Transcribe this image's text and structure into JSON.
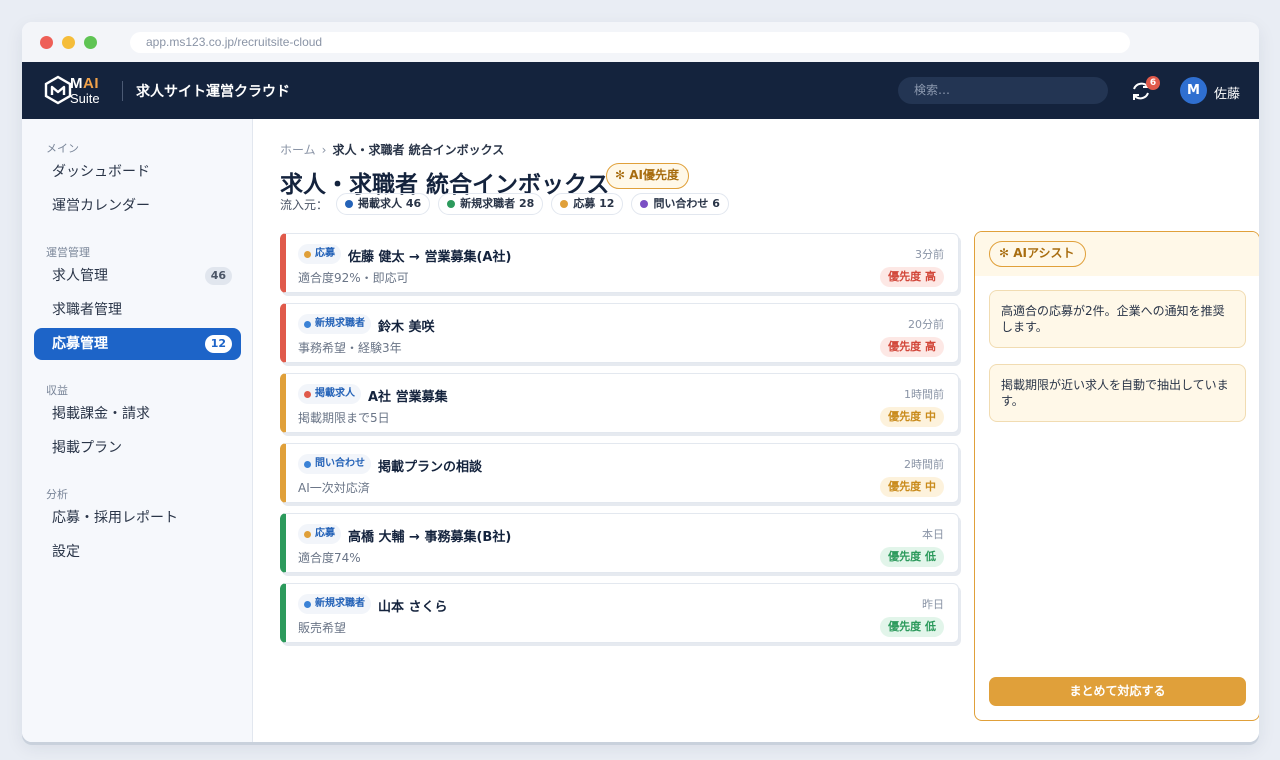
{
  "browser": {
    "url": "app.ms123.co.jp/recruitsite-cloud"
  },
  "appbar": {
    "logo_mai_m": "M",
    "logo_mai_ai": "AI",
    "logo_suite": "Suite",
    "title": "求人サイト運営クラウド",
    "search_placeholder": "検索…",
    "sync_badge": "6",
    "avatar_initial": "M",
    "user_name": "佐藤"
  },
  "sidebar": {
    "sections": [
      {
        "label": "メイン"
      },
      {
        "label": "運営管理"
      },
      {
        "label": "収益"
      },
      {
        "label": "分析"
      }
    ],
    "items": [
      {
        "label": "ダッシュボード"
      },
      {
        "label": "運営カレンダー"
      },
      {
        "label": "求人管理",
        "badge": "46"
      },
      {
        "label": "求職者管理"
      },
      {
        "label": "応募管理",
        "badge": "12",
        "active": true
      },
      {
        "label": "掲載課金・請求"
      },
      {
        "label": "掲載プラン"
      },
      {
        "label": "応募・採用レポート"
      },
      {
        "label": "設定"
      }
    ]
  },
  "main": {
    "breadcrumb": {
      "home": "ホーム",
      "sep": "›",
      "current": "求人・求職者 統合インボックス"
    },
    "title": "求人・求職者 統合インボックス",
    "ai_badge": "AI優先度",
    "sources_label": "流入元：",
    "sources": [
      {
        "label": "掲載求人 46",
        "color": "#2563b8"
      },
      {
        "label": "新規求職者 28",
        "color": "#2c9a5c"
      },
      {
        "label": "応募 12",
        "color": "#e0a03a"
      },
      {
        "label": "問い合わせ 6",
        "color": "#7b4fc4"
      }
    ],
    "cards": [
      {
        "tag": "応募",
        "tag_color": "#e0a03a",
        "title": "佐藤 健太 → 営業募集(A社)",
        "sub": "適合度92%・即応可",
        "time": "3分前",
        "priority": "優先度 高",
        "level": "high",
        "bar": "#e05a4b"
      },
      {
        "tag": "新規求職者",
        "tag_color": "#3b82d6",
        "title": "鈴木 美咲",
        "sub": "事務希望・経験3年",
        "time": "20分前",
        "priority": "優先度 高",
        "level": "high",
        "bar": "#e05a4b"
      },
      {
        "tag": "掲載求人",
        "tag_color": "#e05a4b",
        "title": "A社 営業募集",
        "sub": "掲載期限まで5日",
        "time": "1時間前",
        "priority": "優先度 中",
        "level": "mid",
        "bar": "#e0a03a"
      },
      {
        "tag": "問い合わせ",
        "tag_color": "#3b82d6",
        "title": "掲載プランの相談",
        "sub": "AI一次対応済",
        "time": "2時間前",
        "priority": "優先度 中",
        "level": "mid",
        "bar": "#e0a03a"
      },
      {
        "tag": "応募",
        "tag_color": "#e0a03a",
        "title": "高橋 大輔 → 事務募集(B社)",
        "sub": "適合度74%",
        "time": "本日",
        "priority": "優先度 低",
        "level": "low",
        "bar": "#2c9a5c"
      },
      {
        "tag": "新規求職者",
        "tag_color": "#3b82d6",
        "title": "山本 さくら",
        "sub": "販売希望",
        "time": "昨日",
        "priority": "優先度 低",
        "level": "low",
        "bar": "#2c9a5c"
      }
    ]
  },
  "assist": {
    "title": "AIアシスト",
    "messages": [
      "高適合の応募が2件。企業への通知を推奨します。",
      "掲載期限が近い求人を自動で抽出しています。"
    ],
    "action_label": "まとめて対応する"
  },
  "colors": {
    "navy": "#14233d",
    "accent": "#1d64c8",
    "ai": "#e0a03a"
  }
}
